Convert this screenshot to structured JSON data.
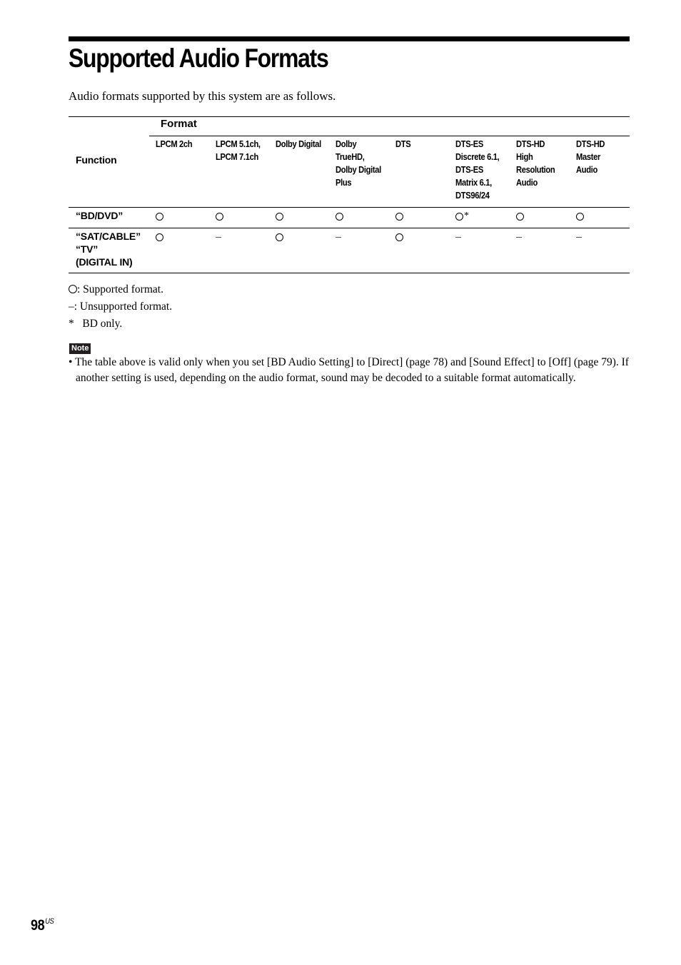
{
  "page": {
    "title": "Supported Audio Formats",
    "intro": "Audio formats supported by this system are as follows.",
    "page_number": "98",
    "page_number_suffix": "US"
  },
  "table": {
    "function_header": "Function",
    "format_header": "Format",
    "columns": [
      "LPCM 2ch",
      "LPCM 5.1ch,\nLPCM 7.1ch",
      "Dolby Digital",
      "Dolby\nTrueHD,\nDolby Digital\nPlus",
      "DTS",
      "DTS-ES\nDiscrete 6.1,\nDTS-ES\nMatrix 6.1,\nDTS96/24",
      "DTS-HD\nHigh\nResolution\nAudio",
      "DTS-HD\nMaster\nAudio"
    ],
    "rows": [
      {
        "function": "“BD/DVD”",
        "values": [
          "supported",
          "supported",
          "supported",
          "supported",
          "supported",
          "supported*",
          "supported",
          "supported"
        ]
      },
      {
        "function": "“SAT/CABLE”\n“TV”\n(DIGITAL IN)",
        "values": [
          "supported",
          "unsupported",
          "supported",
          "unsupported",
          "supported",
          "unsupported",
          "unsupported",
          "unsupported"
        ]
      }
    ]
  },
  "legend": {
    "supported": ": Supported format.",
    "unsupported": "–: Unsupported format.",
    "footnote_mark": "*",
    "footnote": "BD only."
  },
  "note": {
    "label": "Note",
    "text": "• The table above is valid only when you set [BD Audio Setting] to [Direct] (page 78) and [Sound Effect] to [Off] (page 79). If another setting is used, depending on the audio format, sound may be decoded to a suitable format automatically."
  }
}
